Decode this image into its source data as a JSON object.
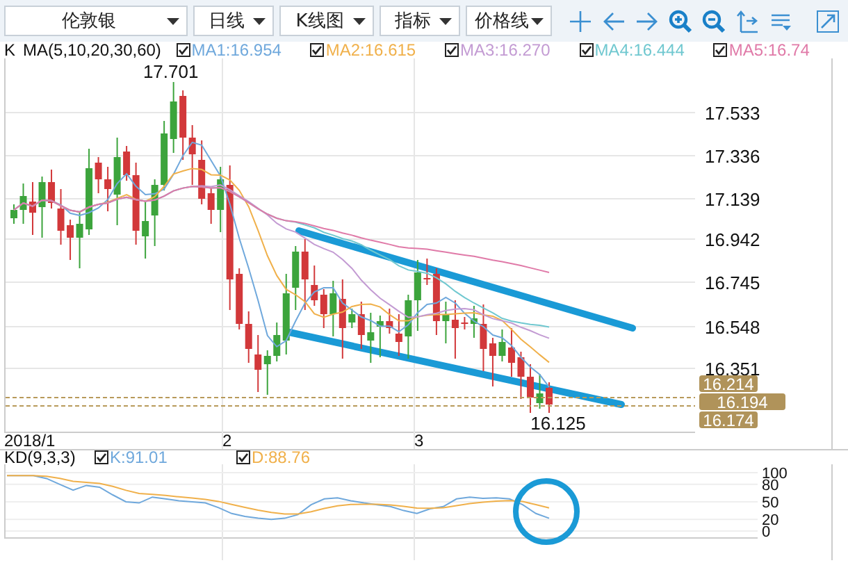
{
  "toolbar": {
    "dropdowns": [
      {
        "label": "伦敦银"
      },
      {
        "label": "日线"
      },
      {
        "label": "K线图"
      },
      {
        "label": "指标"
      },
      {
        "label": "价格线"
      }
    ]
  },
  "price_chart": {
    "indicator_label": "K",
    "ma_label": "MA(5,10,20,30,60)",
    "ma_lines": [
      {
        "label": "MA1:16.954",
        "color": "#6fa8dc",
        "checked": true
      },
      {
        "label": "MA2:16.615",
        "color": "#f0b04a",
        "checked": true
      },
      {
        "label": "MA3:16.270",
        "color": "#c39bd3",
        "checked": true
      },
      {
        "label": "MA4:16.444",
        "color": "#70c8d0",
        "checked": true
      },
      {
        "label": "MA5:16.74",
        "color": "#e07aa8",
        "checked": true
      }
    ],
    "high_label": "17.701",
    "low_label": "16.125",
    "y_axis_labels": [
      "17.533",
      "17.336",
      "17.139",
      "16.942",
      "16.745",
      "16.548",
      "16.351"
    ],
    "price_tags": [
      "16.214",
      "16.194",
      "16.174"
    ],
    "x_axis_labels": [
      "2018/1",
      "2",
      "3"
    ]
  },
  "kd_chart": {
    "label": "KD(9,3,3)",
    "lines": [
      {
        "label": "K:91.01",
        "color": "#6fa8dc",
        "checked": true
      },
      {
        "label": "D:88.76",
        "color": "#f0b04a",
        "checked": true
      }
    ],
    "y_axis_labels": [
      "100",
      "80",
      "50",
      "20",
      "0"
    ]
  }
}
